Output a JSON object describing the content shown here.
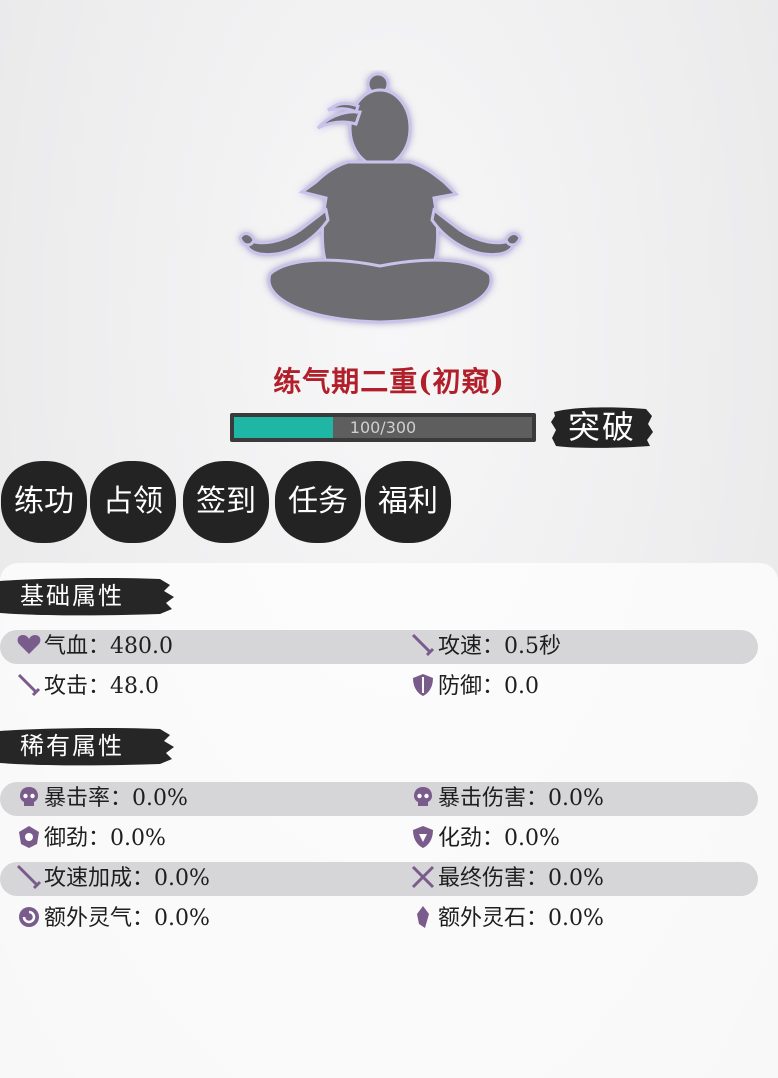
{
  "character": {
    "realm": "练气期二重(初窥)",
    "cultivation_progress": {
      "current": 100,
      "max": 300,
      "label": "100/300"
    },
    "breakthrough_label": "突破"
  },
  "actions": [
    {
      "label": "练功"
    },
    {
      "label": "占领"
    },
    {
      "label": "签到"
    },
    {
      "label": "任务"
    },
    {
      "label": "福利"
    }
  ],
  "basic_attributes": {
    "title": "基础属性",
    "stats": [
      {
        "icon": "heart-icon",
        "label": "气血：",
        "value": "480.0"
      },
      {
        "icon": "sword-icon",
        "label": "攻速：",
        "value": "0.5秒"
      },
      {
        "icon": "sword-icon",
        "label": "攻击：",
        "value": "48.0"
      },
      {
        "icon": "shield-icon",
        "label": "防御：",
        "value": "0.0"
      }
    ]
  },
  "rare_attributes": {
    "title": "稀有属性",
    "stats": [
      {
        "icon": "skull-icon",
        "label": "暴击率：",
        "value": "0.0%"
      },
      {
        "icon": "skull-icon",
        "label": "暴击伤害：",
        "value": "0.0%"
      },
      {
        "icon": "guard-icon",
        "label": "御劲：",
        "value": "0.0%"
      },
      {
        "icon": "dissolve-icon",
        "label": "化劲：",
        "value": "0.0%"
      },
      {
        "icon": "blade-icon",
        "label": "攻速加成：",
        "value": "0.0%"
      },
      {
        "icon": "crossed-swords-icon",
        "label": "最终伤害：",
        "value": "0.0%"
      },
      {
        "icon": "spiral-icon",
        "label": "额外灵气：",
        "value": "0.0%"
      },
      {
        "icon": "crystal-icon",
        "label": "额外灵石：",
        "value": "0.0%"
      }
    ]
  },
  "colors": {
    "realm_text": "#b1202a",
    "progress_fill": "#20b6a6",
    "ink": "#1b1b1b",
    "icon_purple": "#7a5c8c"
  }
}
